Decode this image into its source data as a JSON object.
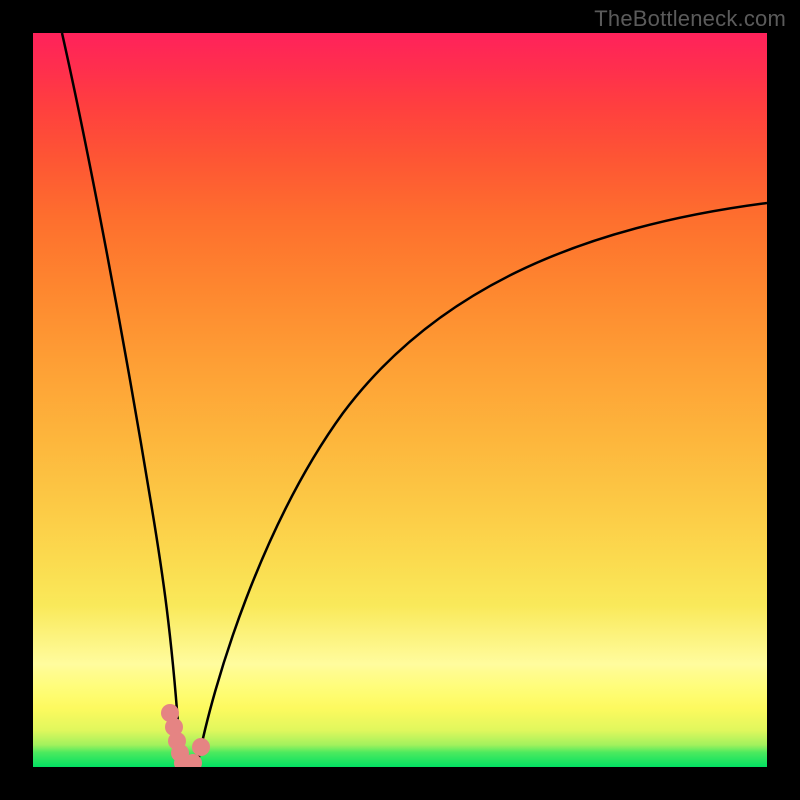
{
  "watermark": "TheBottleneck.com",
  "chart_data": {
    "type": "line",
    "title": "",
    "xlabel": "",
    "ylabel": "",
    "xlim": [
      0,
      100
    ],
    "ylim": [
      0,
      100
    ],
    "grid": false,
    "legend": false,
    "series": [
      {
        "name": "left-curve",
        "x": [
          4,
          6,
          8,
          10,
          12,
          14,
          15,
          16,
          17,
          18,
          18.6,
          19,
          19.4,
          19.8,
          20.0,
          20.1
        ],
        "values": [
          100,
          84,
          69,
          55,
          42,
          30,
          25,
          19.5,
          14.8,
          10.4,
          7.4,
          5.8,
          4.2,
          2.7,
          1.4,
          0
        ]
      },
      {
        "name": "right-curve",
        "x": [
          22.4,
          23,
          24,
          26,
          28,
          30,
          33,
          36,
          40,
          45,
          50,
          55,
          60,
          65,
          70,
          75,
          80,
          85,
          90,
          95,
          100
        ],
        "values": [
          0,
          2.7,
          6.1,
          11.6,
          16.3,
          20.4,
          25.9,
          30.6,
          36.1,
          41.8,
          46.9,
          51.4,
          55.4,
          59.0,
          62.3,
          65.3,
          68.0,
          70.5,
          72.8,
          74.9,
          76.9
        ]
      },
      {
        "name": "pink-markers",
        "x": [
          18.6,
          19.4,
          19.8,
          20.0,
          20.1,
          22.4,
          23.0
        ],
        "values": [
          7.4,
          4.2,
          2.7,
          1.4,
          0.0,
          0.0,
          2.7
        ]
      }
    ],
    "colors": {
      "curves": "#000000",
      "markers": "#e58483"
    }
  }
}
